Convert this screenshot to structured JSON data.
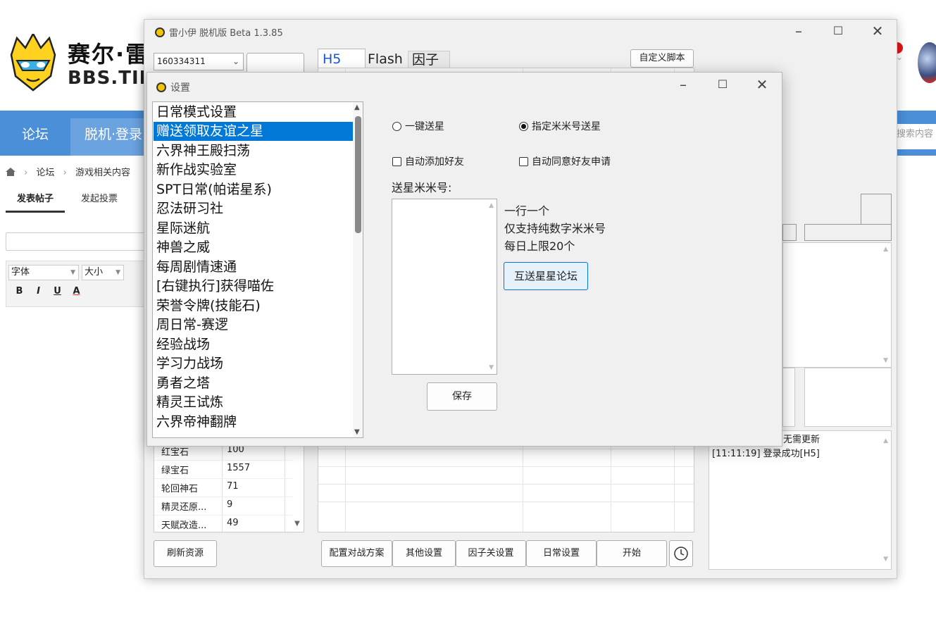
{
  "forum": {
    "site_name": "赛尔·雷",
    "site_url": "BBS.TIE",
    "nav": {
      "forum": "论坛",
      "offline_login": "脱机·登录"
    },
    "search_placeholder": "搜索内容",
    "breadcrumb": [
      "论坛",
      "游戏相关内容"
    ],
    "post_tabs": {
      "post": "发表帖子",
      "vote": "发起投票"
    },
    "editor": {
      "font_label": "字体",
      "size_label": "大小",
      "toolbar": [
        "B",
        "I",
        "U",
        "A"
      ]
    }
  },
  "main_window": {
    "title": "雷小伊 脱机版 Beta 1.3.85",
    "account": "160334311",
    "tabs": [
      "H5",
      "Flash",
      "因子"
    ],
    "custom_script": "自定义脚本",
    "resources": [
      {
        "name": "红宝石",
        "value": "100"
      },
      {
        "name": "绿宝石",
        "value": "1557"
      },
      {
        "name": "轮回神石",
        "value": "71"
      },
      {
        "name": "精灵还原...",
        "value": "9"
      },
      {
        "name": "天赋改造...",
        "value": "49"
      }
    ],
    "refresh_button": "刷新资源",
    "bottom_buttons": [
      "配置对战方案",
      "其他设置",
      "因子关设置",
      "日常设置",
      "开始"
    ],
    "log": [
      "无需更新",
      "[11:11:19] 登录成功[H5]"
    ]
  },
  "settings_dialog": {
    "title": "设置",
    "menu_items": [
      "日常模式设置",
      "赠送领取友谊之星",
      "六界神王殿扫荡",
      "新作战实验室",
      "SPT日常(帕诺星系)",
      "忍法研习社",
      "星际迷航",
      "神兽之威",
      "每周剧情速通",
      "[右键执行]获得喵佐",
      "荣誉令牌(技能石)",
      "周日常-赛逻",
      "经验战场",
      "学习力战场",
      "勇者之塔",
      "精灵王试炼",
      "六界帝神翻牌"
    ],
    "selected_index": 1,
    "radio_one_click": "一键送星",
    "radio_specified": "指定米米号送星",
    "checkbox_add_friend": "自动添加好友",
    "checkbox_accept_request": "自动同意好友申请",
    "star_ids_label": "送星米米号:",
    "hints": [
      "一行一个",
      "仅支持纯数字米米号",
      "每日上限20个"
    ],
    "forum_button": "互送星星论坛",
    "save_button": "保存"
  }
}
